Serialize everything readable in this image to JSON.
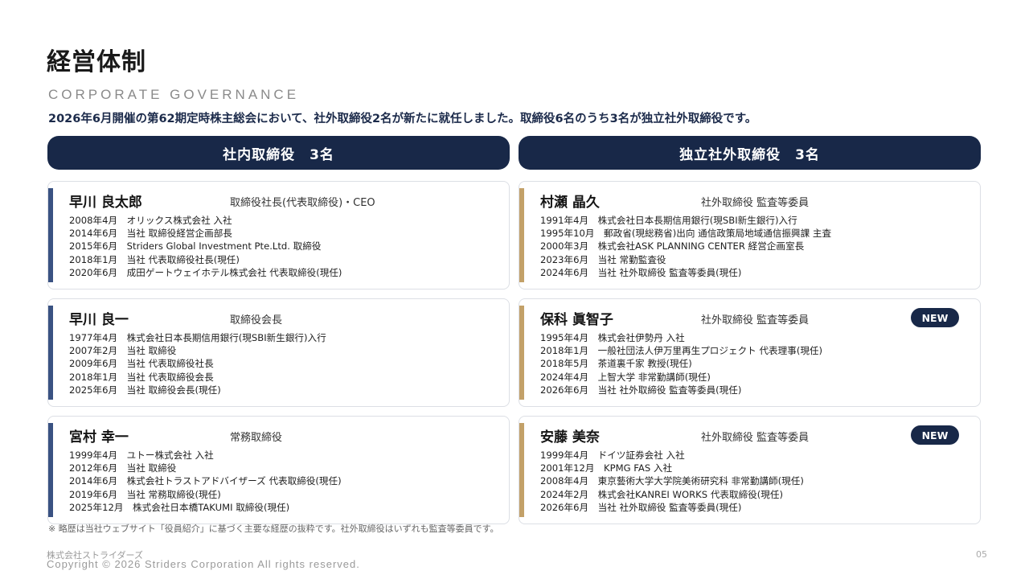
{
  "header": {
    "title": "経営体制",
    "subtitle": "CORPORATE GOVERNANCE",
    "lead": "2026年6月開催の第62期定時株主総会において、社外取締役2名が新たに就任しました。取締役6名のうち3名が独立社外取締役です。"
  },
  "columns": {
    "inside_title": "社内取締役　3名",
    "outside_title": "独立社外取締役　3名"
  },
  "inside": [
    {
      "name": "早川 良太郎",
      "role": "取締役社長(代表取締役)・CEO",
      "badge": "",
      "history": [
        "2008年4月　オリックス株式会社 入社",
        "2014年6月　当社 取締役経営企画部長",
        "2015年6月　Striders Global Investment Pte.Ltd. 取締役",
        "2018年1月　当社 代表取締役社長(現任)",
        "2020年6月　成田ゲートウェイホテル株式会社 代表取締役(現任)"
      ]
    },
    {
      "name": "早川 良一",
      "role": "取締役会長",
      "badge": "",
      "history": [
        "1977年4月　株式会社日本長期信用銀行(現SBI新生銀行)入行",
        "2007年2月　当社 取締役",
        "2009年6月　当社 代表取締役社長",
        "2018年1月　当社 代表取締役会長",
        "2025年6月　当社 取締役会長(現任)"
      ]
    },
    {
      "name": "宮村 幸一",
      "role": "常務取締役",
      "badge": "",
      "history": [
        "1999年4月　ユトー株式会社 入社",
        "2012年6月　当社 取締役",
        "2014年6月　株式会社トラストアドバイザーズ 代表取締役(現任)",
        "2019年6月　当社 常務取締役(現任)",
        "2025年12月　株式会社日本橋TAKUMI 取締役(現任)"
      ]
    }
  ],
  "outside": [
    {
      "name": "村瀬 晶久",
      "role": "社外取締役 監査等委員",
      "badge": "",
      "history": [
        "1991年4月　株式会社日本長期信用銀行(現SBI新生銀行)入行",
        "1995年10月　郵政省(現総務省)出向 通信政策局地域通信振興課 主査",
        "2000年3月　株式会社ASK PLANNING CENTER 経営企画室長",
        "2023年6月　当社 常勤監査役",
        "2024年6月　当社 社外取締役 監査等委員(現任)"
      ]
    },
    {
      "name": "保科 眞智子",
      "role": "社外取締役 監査等委員",
      "badge": "NEW",
      "history": [
        "1995年4月　株式会社伊勢丹 入社",
        "2018年1月　一般社団法人伊万里再生プロジェクト 代表理事(現任)",
        "2018年5月　茶道裏千家 教授(現任)",
        "2024年4月　上智大学 非常勤講師(現任)",
        "2026年6月　当社 社外取締役 監査等委員(現任)"
      ]
    },
    {
      "name": "安藤 美奈",
      "role": "社外取締役 監査等委員",
      "badge": "NEW",
      "history": [
        "1999年4月　ドイツ証券会社 入社",
        "2001年12月　KPMG FAS 入社",
        "2008年4月　東京藝術大学大学院美術研究科 非常勤講師(現任)",
        "2024年2月　株式会社KANREI WORKS 代表取締役(現任)",
        "2026年6月　当社 社外取締役 監査等委員(現任)"
      ]
    }
  ],
  "footer": {
    "note": "※ 略歴は当社ウェブサイト「役員紹介」に基づく主要な経歴の抜粋です。社外取締役はいずれも監査等委員です。",
    "company": "株式会社ストライダーズ",
    "copyright": "Copyright © 2026 Striders Corporation All rights reserved.",
    "page": "05"
  },
  "colors": {
    "navy": "#182848",
    "inside_accent": "#3a5282",
    "outside_accent": "#c3a169"
  }
}
